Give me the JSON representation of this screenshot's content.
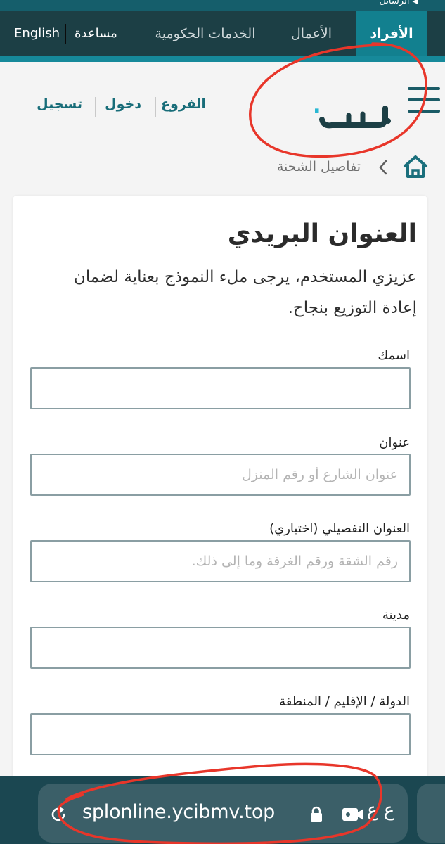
{
  "top_strip": {
    "messages_label": "الرسائل"
  },
  "topnav": {
    "tabs": [
      {
        "label": "الأفراد",
        "active": true
      },
      {
        "label": "الأعمال",
        "active": false
      },
      {
        "label": "الخدمات الحكومية",
        "active": false
      }
    ],
    "help_label": "مساعدة",
    "language_label": "English"
  },
  "header": {
    "branches_label": "الفروع",
    "login_label": "دخول",
    "register_label": "تسجيل",
    "logo_text": "SPL سبل"
  },
  "breadcrumb": {
    "current": "تفاصيل الشحنة"
  },
  "form": {
    "title": "العنوان البريدي",
    "intro": "عزيزي المستخدم، يرجى ملء النموذج بعناية لضمان إعادة التوزيع بنجاح.",
    "fields": [
      {
        "label": "اسمك",
        "placeholder": "",
        "value": ""
      },
      {
        "label": "عنوان",
        "placeholder": "عنوان الشارع أو رقم المنزل",
        "value": ""
      },
      {
        "label": "العنوان التفصيلي (اختياري)",
        "placeholder": "رقم الشقة ورقم الغرفة وما إلى ذلك.",
        "value": ""
      },
      {
        "label": "مدينة",
        "placeholder": "",
        "value": ""
      },
      {
        "label": "الدولة / الإقليم / المنطقة",
        "placeholder": "",
        "value": ""
      }
    ]
  },
  "browser": {
    "url": "splonline.ycibmv.top",
    "lang_indicator": "ع ع"
  },
  "colors": {
    "nav_dark": "#1c3f45",
    "nav_active": "#12808f",
    "brand_teal": "#16899a",
    "link": "#186d79",
    "browser_bar": "#1b4751",
    "annotation_red": "#e8362a"
  },
  "icons": [
    "menu-icon",
    "home-icon",
    "chevron-left-icon",
    "reload-icon",
    "lock-icon",
    "camera-icon"
  ]
}
